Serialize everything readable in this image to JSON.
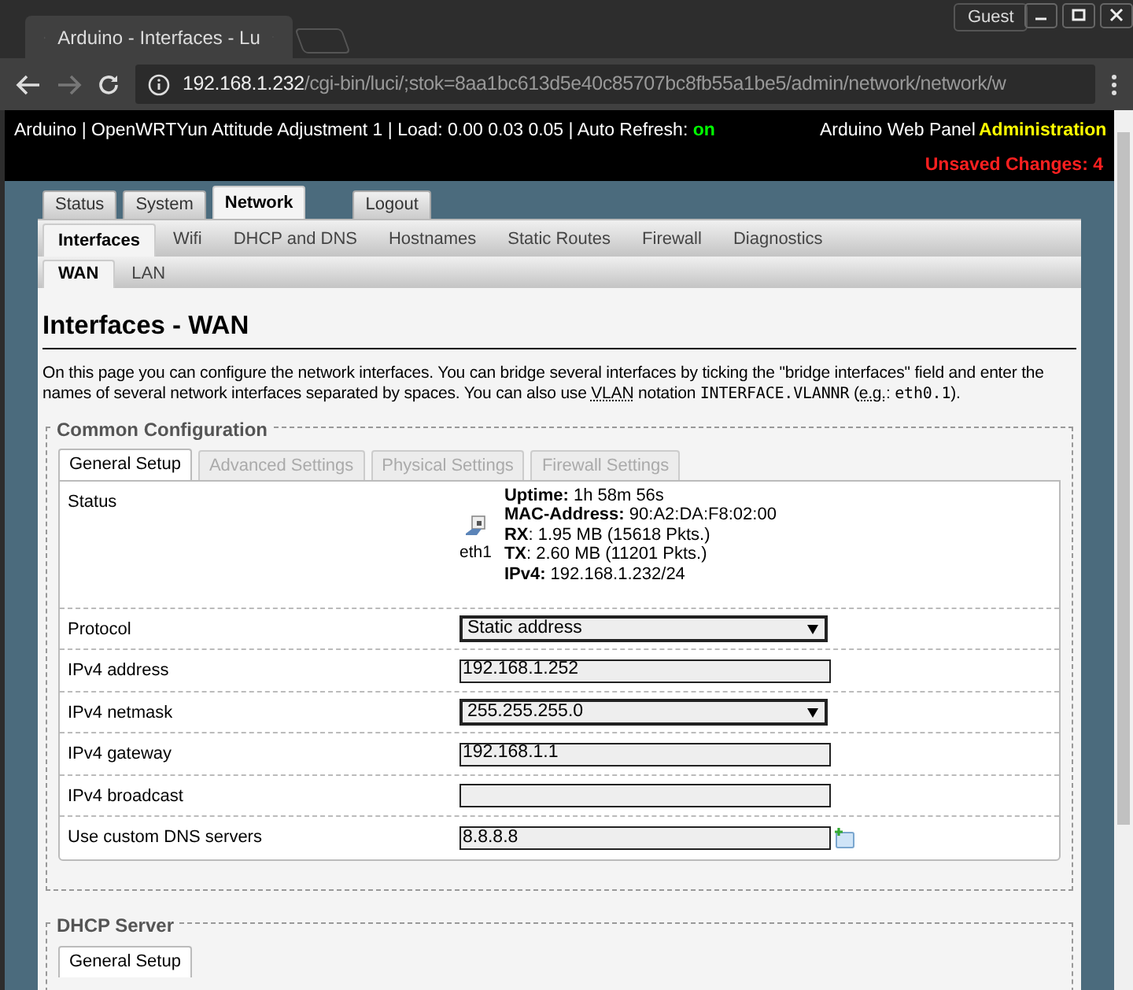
{
  "browser": {
    "tab_title": "Arduino - Interfaces - Lu",
    "user": "Guest",
    "host": "192.168.1.232",
    "path": "/cgi-bin/luci/;stok=8aa1bc613d5e40c85707bc8fb55a1be5/admin/network/network/w"
  },
  "header": {
    "info": "Arduino | OpenWRTYun Attitude Adjustment 1 | Load: 0.00 0.03 0.05 | Auto Refresh:",
    "auto_refresh": "on",
    "panel_link": "Arduino Web Panel",
    "admin_link": "Administration",
    "unsaved": "Unsaved Changes: 4"
  },
  "main_tabs": [
    {
      "label": "Status",
      "selected": false,
      "kind": "tab"
    },
    {
      "label": "System",
      "selected": false,
      "kind": "tab"
    },
    {
      "label": "Network",
      "selected": true,
      "kind": "tab"
    },
    {
      "label": "Logout",
      "selected": false,
      "kind": "action"
    }
  ],
  "sub_tabs": [
    {
      "label": "Interfaces",
      "selected": true
    },
    {
      "label": "Wifi",
      "selected": false
    },
    {
      "label": "DHCP and DNS",
      "selected": false
    },
    {
      "label": "Hostnames",
      "selected": false
    },
    {
      "label": "Static Routes",
      "selected": false
    },
    {
      "label": "Firewall",
      "selected": false
    },
    {
      "label": "Diagnostics",
      "selected": false
    }
  ],
  "interface_tabs": [
    {
      "label": "WAN",
      "selected": true
    },
    {
      "label": "LAN",
      "selected": false
    }
  ],
  "heading": "Interfaces - WAN",
  "description": [
    {
      "kind": "plain",
      "text": "On this page you can configure the network interfaces. You can bridge several interfaces by ticking the \"bridge interfaces\" field and enter the names of several network interfaces separated by spaces. You can also use "
    },
    {
      "kind": "abbr",
      "text": "VLAN"
    },
    {
      "kind": "plain",
      "text": " notation "
    },
    {
      "kind": "code",
      "text": "INTERFACE.VLANNR"
    },
    {
      "kind": "plain",
      "text": " ("
    },
    {
      "kind": "abbr",
      "text": "e.g."
    },
    {
      "kind": "plain",
      "text": ": "
    },
    {
      "kind": "code",
      "text": "eth0.1"
    },
    {
      "kind": "plain",
      "text": ")."
    }
  ],
  "common": {
    "legend": "Common Configuration",
    "tabs": [
      {
        "label": "General Setup",
        "selected": true
      },
      {
        "label": "Advanced Settings",
        "selected": false
      },
      {
        "label": "Physical Settings",
        "selected": false
      },
      {
        "label": "Firewall Settings",
        "selected": false
      }
    ],
    "status": {
      "label": "Status",
      "device": "eth1",
      "lines": [
        "**Uptime:** 1h 58m 56s",
        "**MAC-Address:** 90:A2:DA:F8:02:00",
        "**RX**: 1.95 MB (15618 Pkts.)",
        "**TX**: 2.60 MB (11201 Pkts.)",
        "**IPv4:** 192.168.1.232/24"
      ]
    },
    "fields": [
      {
        "label": "Protocol",
        "kind": "select",
        "value": "Static address"
      },
      {
        "label": "IPv4 address",
        "kind": "text",
        "value": "192.168.1.252"
      },
      {
        "label": "IPv4 netmask",
        "kind": "select",
        "value": "255.255.255.0"
      },
      {
        "label": "IPv4 gateway",
        "kind": "text",
        "value": "192.168.1.1"
      },
      {
        "label": "IPv4 broadcast",
        "kind": "text"
      },
      {
        "label": "Use custom DNS servers",
        "kind": "dynlist",
        "value": "8.8.8.8"
      }
    ]
  },
  "dhcp": {
    "legend": "DHCP Server",
    "tabs": [
      {
        "label": "General Setup",
        "selected": true
      }
    ]
  }
}
